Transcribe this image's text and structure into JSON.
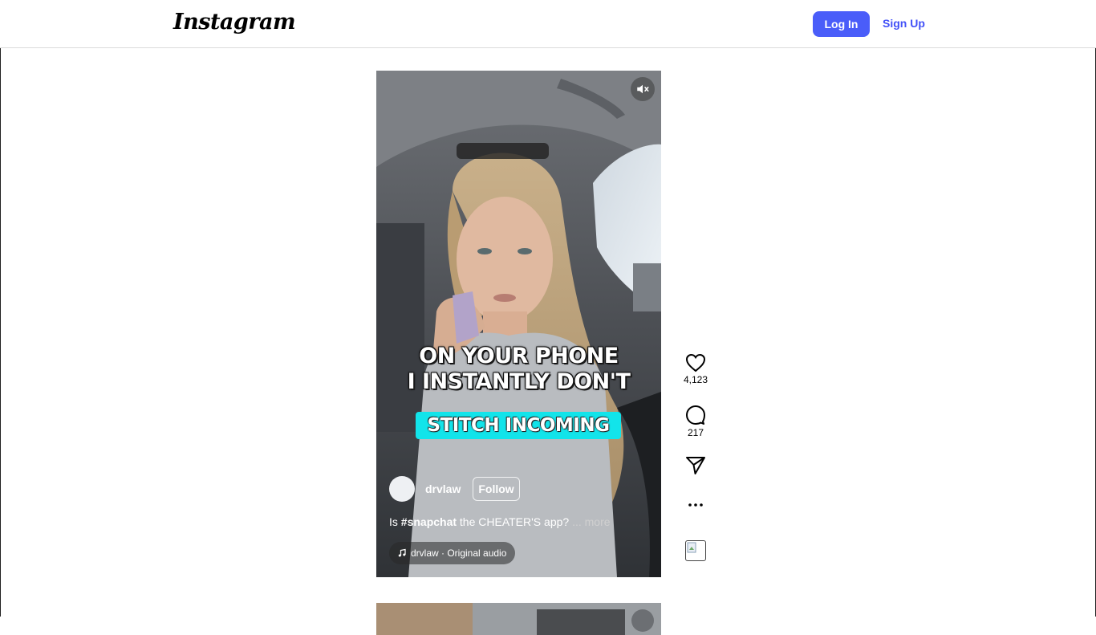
{
  "header": {
    "logo_text": "Instagram",
    "login_label": "Log In",
    "signup_label": "Sign Up"
  },
  "reel": {
    "overlay_line1": "ON YOUR PHONE",
    "overlay_line2": "I INSTANTLY DON'T",
    "overlay_stitch": "STITCH INCOMING",
    "author": "drvlaw",
    "follow_label": "Follow",
    "description_prefix": "Is ",
    "description_hashtag": "#snapchat",
    "description_suffix": " the CHEATER'S app?",
    "more_label": "... more",
    "audio_label": "drvlaw · Original audio",
    "mute_icon": "speaker-muted-icon"
  },
  "actions": {
    "likes": "4,123",
    "comments": "217"
  },
  "colors": {
    "primary": "#4a5df9",
    "link": "#4150f7",
    "stitch_bg": "#12e4ea"
  }
}
